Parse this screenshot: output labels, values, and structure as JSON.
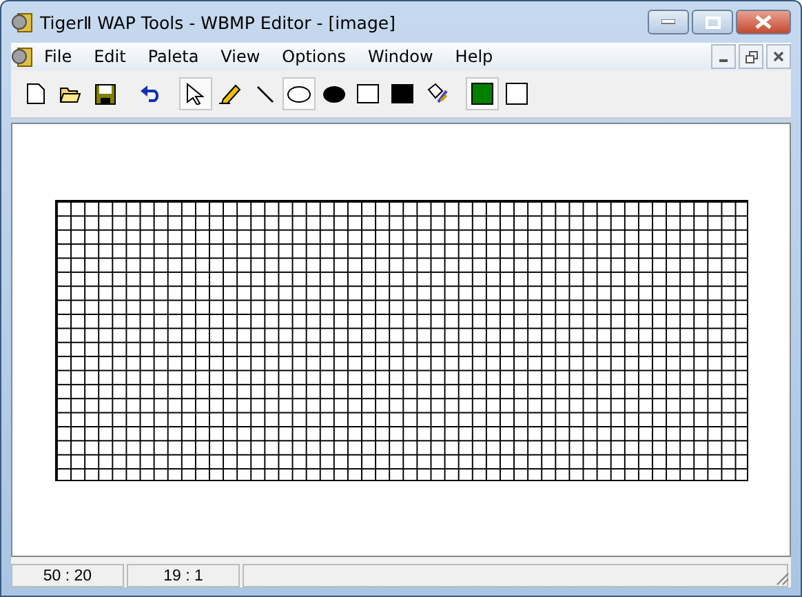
{
  "window": {
    "title": "TigerⅡ WAP Tools - WBMP Editor - [image]"
  },
  "menu": [
    "File",
    "Edit",
    "Paleta",
    "View",
    "Options",
    "Window",
    "Help"
  ],
  "toolbar": [
    {
      "kind": "new",
      "selected": false
    },
    {
      "kind": "open",
      "selected": false
    },
    {
      "kind": "save",
      "selected": false
    },
    {
      "kind": "undo",
      "selected": false
    },
    {
      "kind": "select",
      "selected": true
    },
    {
      "kind": "pencil",
      "selected": false
    },
    {
      "kind": "line",
      "selected": false
    },
    {
      "kind": "ellipse",
      "selected": true
    },
    {
      "kind": "filled-ellipse",
      "selected": false
    },
    {
      "kind": "rectangle",
      "selected": false
    },
    {
      "kind": "filled-rectangle",
      "selected": false
    },
    {
      "kind": "fill",
      "selected": false
    }
  ],
  "palette": [
    {
      "color": "#008000",
      "selected": true
    },
    {
      "color": "#ffffff",
      "selected": false
    }
  ],
  "status_bar": [
    "50 : 20",
    "19 : 1"
  ]
}
